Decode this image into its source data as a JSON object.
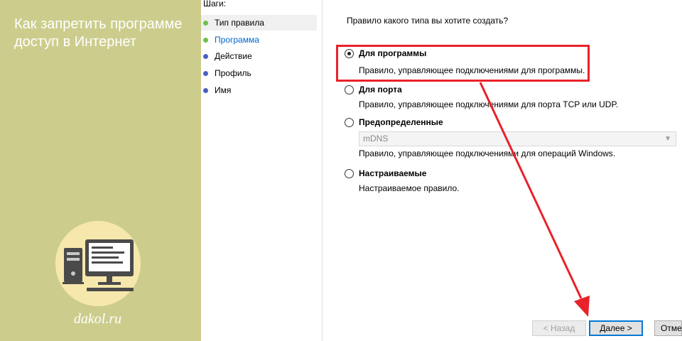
{
  "article": {
    "title": "Как запретить программе доступ в Интернет",
    "site": "dakol.ru"
  },
  "steps": {
    "header": "Шаги:",
    "items": [
      {
        "label": "Тип правила",
        "color": "#6cc04a"
      },
      {
        "label": "Программа",
        "color": "#6cc04a"
      },
      {
        "label": "Действие",
        "color": "#4a5fc0"
      },
      {
        "label": "Профиль",
        "color": "#4a5fc0"
      },
      {
        "label": "Имя",
        "color": "#4a5fc0"
      }
    ]
  },
  "main": {
    "question": "Правило какого типа вы хотите создать?",
    "options": [
      {
        "title": "Для программы",
        "desc": "Правило, управляющее подключениями для программы.",
        "checked": true
      },
      {
        "title": "Для порта",
        "desc": "Правило, управляющее подключениями для порта TCP или UDP.",
        "checked": false
      },
      {
        "title": "Предопределенные",
        "desc": "Правило, управляющее подключениями для операций Windows.",
        "checked": false
      },
      {
        "title": "Настраиваемые",
        "desc": "Настраиваемое правило.",
        "checked": false
      }
    ],
    "predefined_select": {
      "value": "mDNS"
    }
  },
  "buttons": {
    "back": "< Назад",
    "next": "Далее >",
    "cancel": "Отмена"
  },
  "colors": {
    "panel": "#cccd8c",
    "highlight": "#e8222a",
    "accent": "#0078d7"
  }
}
